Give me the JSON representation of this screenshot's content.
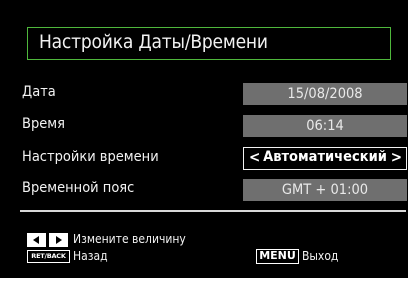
{
  "title": "Настройка Даты/Времени",
  "rows": [
    {
      "label": "Дата",
      "value": "15/08/2008"
    },
    {
      "label": "Время",
      "value": "06:14"
    },
    {
      "label": "Настройки времени",
      "value": "Автоматический"
    },
    {
      "label": "Временной пояс",
      "value": "GMT + 01:00"
    }
  ],
  "selector": {
    "left_arrow": "<",
    "right_arrow": ">"
  },
  "legend": {
    "change_value": "Измените величину",
    "retback_key": "RET/BACK",
    "back": "Назад",
    "menu_key": "MENU",
    "exit": "Выход"
  },
  "colors": {
    "background": "#000000",
    "title_border": "#4fb83c",
    "value_bg": "#6f6f6f",
    "text": "#f2f2f2"
  },
  "icons": [
    "left-arrow-key-icon",
    "right-arrow-key-icon"
  ]
}
